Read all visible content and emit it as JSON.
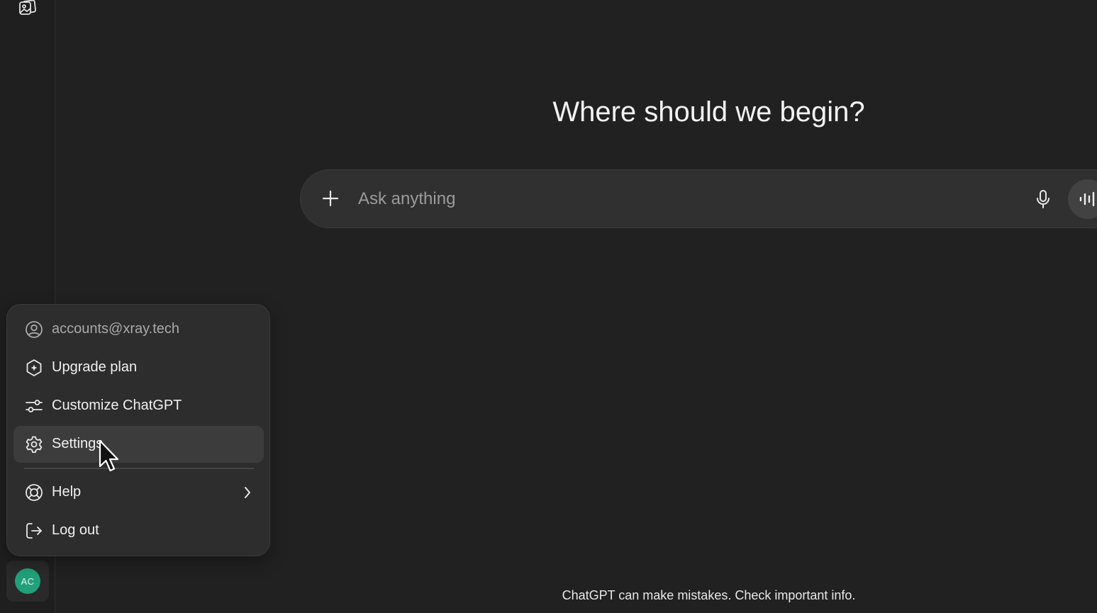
{
  "main": {
    "heading": "Where should we begin?",
    "composer": {
      "placeholder": "Ask anything"
    },
    "footer_note": "ChatGPT can make mistakes. Check important info."
  },
  "sidebar": {
    "top_icon": "images-icon",
    "avatar_initials": "AC",
    "avatar_color": "#21a07a"
  },
  "account_menu": {
    "items": [
      {
        "label": "accounts@xray.tech",
        "icon": "user-circle-icon"
      },
      {
        "label": "Upgrade plan",
        "icon": "upgrade-badge-icon"
      },
      {
        "label": "Customize ChatGPT",
        "icon": "sliders-icon"
      },
      {
        "label": "Settings",
        "icon": "gear-icon",
        "highlighted": true
      },
      {
        "label": "Help",
        "icon": "lifebuoy-icon",
        "submenu": true
      },
      {
        "label": "Log out",
        "icon": "logout-icon"
      }
    ]
  },
  "colors": {
    "background": "#212121",
    "menu_bg": "#2d2d2d",
    "hover_bg": "#3c3c3c",
    "composer_bg": "#303030"
  }
}
